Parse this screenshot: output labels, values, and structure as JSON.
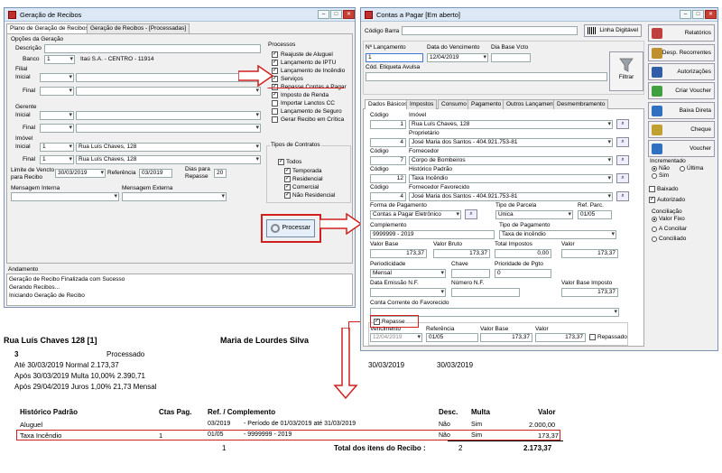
{
  "left_window": {
    "title": "Geração de Recibos",
    "tabs": [
      "Plano de Geração de Recibos",
      "Geração de Recibos - [Processadas]"
    ],
    "opcoes_label": "Opções da Geração",
    "descricao_label": "Descrição",
    "banco_label": "Banco",
    "banco_code": "1",
    "banco_name": "Itaú S.A. - CENTRO - 11914",
    "filial_label": "Filial",
    "inicial_label": "Inicial",
    "final_label": "Final",
    "gerente_label": "Gerente",
    "imovel_label": "Imóvel",
    "imovel_inicial_code": "1",
    "imovel_inicial_name": "Rua Luís Chaves, 128",
    "imovel_final_code": "1",
    "imovel_final_name": "Rua Luís Chaves, 128",
    "limite_label": "Limite de Vencto para Recibo",
    "limite_value": "30/03/2019",
    "referencia_label": "Referência",
    "referencia_value": "03/2019",
    "dias_label": "Dias para Repasse",
    "dias_value": "20",
    "msg_interna_label": "Mensagem Interna",
    "msg_externa_label": "Mensagem Externa",
    "processos_label": "Processos",
    "processos": [
      {
        "label": "Reajuste de Aluguel",
        "checked": true
      },
      {
        "label": "Lançamento de IPTU",
        "checked": true
      },
      {
        "label": "Lançamento de Incêndio",
        "checked": true
      },
      {
        "label": "Serviços",
        "checked": true
      },
      {
        "label": "Repasse Contas a Pagar",
        "checked": true
      },
      {
        "label": "Imposto de Renda",
        "checked": true
      },
      {
        "label": "Importar Lanctos CC",
        "checked": false
      },
      {
        "label": "Lançamento de Seguro",
        "checked": false
      },
      {
        "label": "Gerar Recibo em Crítica",
        "checked": false
      }
    ],
    "tipos_label": "Tipos de Contratos",
    "todos_label": "Todos",
    "tipos": [
      "Temporada",
      "Residencial",
      "Comercial",
      "Não Residencial"
    ],
    "processar_label": "Processar",
    "andamento_label": "Andamento",
    "andamento_lines": [
      "Geração de Recibo Finalizada com Sucesso",
      "Gerando Recibos...",
      "Iniciando Geração de Recibo"
    ]
  },
  "right_window": {
    "title": "Contas a Pagar [Em aberto]",
    "codigo_barra_label": "Código Barra",
    "linha_digitavel_label": "Linha Digitável",
    "n_lancamento_label": "Nº Lançamento",
    "n_lancamento_value": "1",
    "data_vencimento_label": "Data do Vencimento",
    "data_vencimento_value": "12/04/2019",
    "dia_base_label": "Dia Base Vcto",
    "cod_etiqueta_label": "Cód. Etiqueta Avulsa",
    "filtrar_label": "Filtrar",
    "side_buttons": [
      "Relatórios",
      "Desp. Recorrentes",
      "Autorizações",
      "Criar Voucher",
      "Baixa Direta",
      "Cheque",
      "Voucher"
    ],
    "incrementado_label": "Incrementado",
    "incrementado_options": [
      "Não",
      "Última",
      "Sim"
    ],
    "baixado_label": "Baixado",
    "autorizado_label": "Autorizado",
    "conciliacao_label": "Conciliação",
    "conciliacao_options": [
      "Valor Fixo",
      "A Conciliar",
      "Conciliado"
    ],
    "tabs": [
      "Dados Básicos",
      "Impostos",
      "Consumo",
      "Pagamento",
      "Outros Lançamentos",
      "Desmembramento"
    ],
    "codigo_label": "Código",
    "imovel_label": "Imóvel",
    "imovel_code": "1",
    "imovel_name": "Rua Luís Chaves, 128",
    "proprietario_label": "Proprietário",
    "proprietario_code": "4",
    "proprietario_name": "José Maria dos Santos - 404.921.753-81",
    "fornecedor_label": "Fornecedor",
    "fornecedor_code": "7",
    "fornecedor_name": "Corpo de Bombeiros",
    "historico_label": "Histórico Padrão",
    "historico_code": "12",
    "historico_name": "Taxa Incêndio",
    "favorecido_label": "Fornecedor Favorecido",
    "favorecido_code": "4",
    "favorecido_name": "José Maria dos Santos - 404.921.753-81",
    "forma_pgto_label": "Forma de Pagamento",
    "forma_pgto_value": "Contas a Pagar Eletrônico",
    "tipo_parcela_label": "Tipo de Parcela",
    "tipo_parcela_value": "Única",
    "ref_parc_label": "Ref. Parc.",
    "ref_parc_value": "01/05",
    "complemento_label": "Complemento",
    "complemento_value": "9999999 - 2019",
    "tipo_pgto_label": "Tipo de Pagamento",
    "tipo_pgto_value": "Taxa de incêndio",
    "valor_base_label": "Valor Base",
    "valor_base_value": "173,37",
    "valor_bruto_label": "Valor Bruto",
    "valor_bruto_value": "173,37",
    "total_impostos_label": "Total Impostos",
    "total_impostos_value": "0,00",
    "valor_label": "Valor",
    "valor_value": "173,37",
    "periodicidade_label": "Periodicidade",
    "periodicidade_value": "Mensal",
    "chave_label": "Chave",
    "prioridade_label": "Prioridade de Pgto",
    "prioridade_value": "0",
    "data_emissao_label": "Data Emissão N.F.",
    "numero_nf_label": "Número N.F.",
    "valor_base_imposto_label": "Valor Base Imposto",
    "valor_base_imposto_value": "173,37",
    "conta_corrente_label": "Conta Corrente do Favorecido",
    "repasse_label": "Repasse",
    "rep_vencimento_label": "Vencimento",
    "rep_vencimento_value": "12/04/2019",
    "rep_referencia_label": "Referência",
    "rep_referencia_value": "01/05",
    "rep_valor_base_label": "Valor Base",
    "rep_valor_base_value": "173,37",
    "rep_valor_label": "Valor",
    "rep_valor_value": "173,37",
    "repassado_label": "Repassado"
  },
  "receipt": {
    "address": "Rua Luís Chaves 128 [1]",
    "owner": "Maria de Lourdes Silva",
    "number": "3",
    "status": "Processado",
    "line1": "Até 30/03/2019 Normal  2.173,37",
    "line2": "Após 30/03/2019 Multa 10,00% 2.390,71",
    "line3": "Após 29/04/2019 Juros 1,00% 21,73 Mensal",
    "date1": "30/03/2019",
    "date2": "30/03/2019",
    "headers": [
      "Histórico Padrão",
      "Ctas Pag.",
      "Ref. / Complemento",
      "Desc.",
      "Multa",
      "Valor"
    ],
    "rows": [
      {
        "hist": "Aluguel",
        "ctas": "",
        "ref": "03/2019",
        "comp": "-  Período de 01/03/2019 até 31/03/2019",
        "desc": "Não",
        "multa": "Sim",
        "valor": "2.000,00"
      },
      {
        "hist": "Taxa Incêndio",
        "ctas": "1",
        "ref": "01/05",
        "comp": "-  9999999 - 2019",
        "desc": "Não",
        "multa": "Sim",
        "valor": "173,37"
      }
    ],
    "footer_count": "1",
    "total_label": "Total dos itens do Recibo :",
    "total_count": "2",
    "total_value": "2.173,37"
  },
  "colors": {
    "highlight": "#d02020",
    "title_bar": "#dce8f5"
  }
}
